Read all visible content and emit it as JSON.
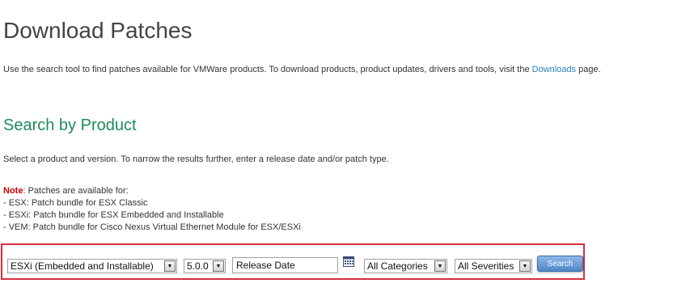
{
  "header": {
    "title": "Download Patches"
  },
  "intro": {
    "text_before": "Use the search tool to find patches available for VMWare products. To download products, product updates, drivers and tools, visit the ",
    "link_text": "Downloads",
    "text_after": " page."
  },
  "search_section": {
    "title": "Search by Product",
    "instructions": "Select a product and version. To narrow the results further, enter a release date and/or patch type."
  },
  "note": {
    "label": "Note",
    "intro": ": Patches are available for:",
    "items": [
      "- ESX: Patch bundle for ESX Classic",
      "- ESXi: Patch bundle for ESX Embedded and Installable",
      "- VEM: Patch bundle for Cisco Nexus Virtual Ethernet Module for ESX/ESXi"
    ]
  },
  "search_form": {
    "product_value": "ESXi (Embedded and Installable)",
    "version_value": "5.0.0",
    "release_date_value": "Release Date",
    "category_value": "All Categories",
    "severity_value": "All Severities",
    "search_label": "Search",
    "dropdown_arrow_glyph": "▼",
    "calendar_icon": "calendar-icon"
  },
  "colors": {
    "section_title": "#1d8a5a",
    "link": "#2e7fbf",
    "note_label": "#cc0000",
    "form_border": "#d62f3a",
    "button": "#4f86c8"
  }
}
